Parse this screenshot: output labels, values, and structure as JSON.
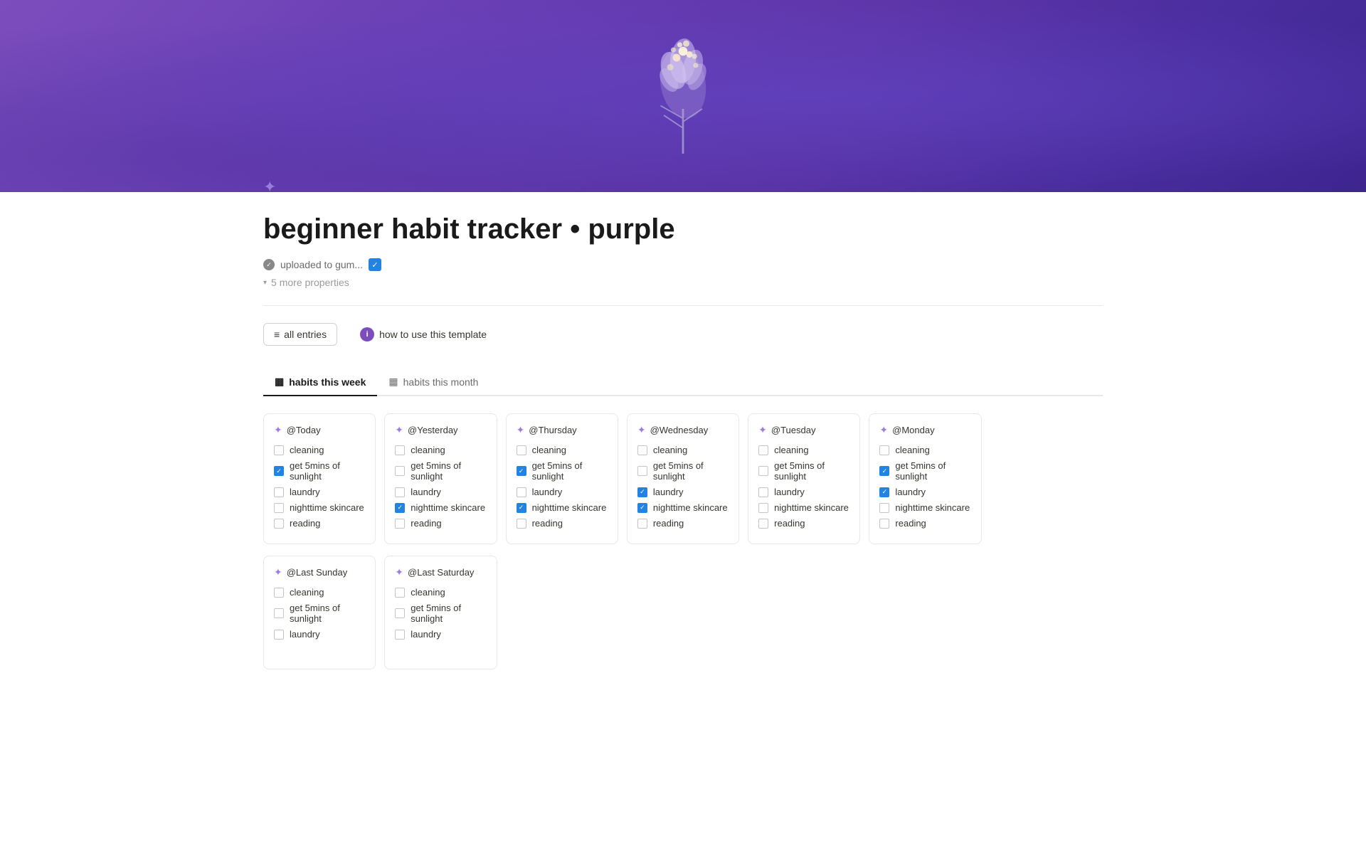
{
  "page": {
    "title": "beginner habit tracker • purple",
    "hero": {
      "alt": "Purple flower bouquet on purple background"
    },
    "properties": {
      "verified_label": "uploaded to gum...",
      "more_label": "5 more properties"
    },
    "actions": {
      "all_entries": "all entries",
      "how_to": "how to use this template"
    },
    "tabs": [
      {
        "id": "habits-week",
        "label": "habits this week",
        "active": true
      },
      {
        "id": "habits-month",
        "label": "habits this month",
        "active": false
      }
    ],
    "week_cards": [
      {
        "day": "@Today",
        "habits": [
          {
            "label": "cleaning",
            "checked": false
          },
          {
            "label": "get 5mins of sunlight",
            "checked": true
          },
          {
            "label": "laundry",
            "checked": false
          },
          {
            "label": "nighttime skincare",
            "checked": false
          },
          {
            "label": "reading",
            "checked": false
          }
        ]
      },
      {
        "day": "@Yesterday",
        "habits": [
          {
            "label": "cleaning",
            "checked": false
          },
          {
            "label": "get 5mins of sunlight",
            "checked": false
          },
          {
            "label": "laundry",
            "checked": false
          },
          {
            "label": "nighttime skincare",
            "checked": true
          },
          {
            "label": "reading",
            "checked": false
          }
        ]
      },
      {
        "day": "@Thursday",
        "habits": [
          {
            "label": "cleaning",
            "checked": false
          },
          {
            "label": "get 5mins of sunlight",
            "checked": true
          },
          {
            "label": "laundry",
            "checked": false
          },
          {
            "label": "nighttime skincare",
            "checked": true
          },
          {
            "label": "reading",
            "checked": false
          }
        ]
      },
      {
        "day": "@Wednesday",
        "habits": [
          {
            "label": "cleaning",
            "checked": false
          },
          {
            "label": "get 5mins of sunlight",
            "checked": false
          },
          {
            "label": "laundry",
            "checked": true
          },
          {
            "label": "nighttime skincare",
            "checked": true
          },
          {
            "label": "reading",
            "checked": false
          }
        ]
      },
      {
        "day": "@Tuesday",
        "habits": [
          {
            "label": "cleaning",
            "checked": false
          },
          {
            "label": "get 5mins of sunlight",
            "checked": false
          },
          {
            "label": "laundry",
            "checked": false
          },
          {
            "label": "nighttime skincare",
            "checked": false
          },
          {
            "label": "reading",
            "checked": false
          }
        ]
      },
      {
        "day": "@Monday",
        "habits": [
          {
            "label": "cleaning",
            "checked": false
          },
          {
            "label": "get 5mins of sunlight",
            "checked": true
          },
          {
            "label": "laundry",
            "checked": true
          },
          {
            "label": "nighttime skincare",
            "checked": false
          },
          {
            "label": "reading",
            "checked": false
          }
        ]
      }
    ],
    "bottom_cards": [
      {
        "day": "@Last Sunday",
        "habits": [
          {
            "label": "cleaning",
            "checked": false
          },
          {
            "label": "get 5mins of sunlight",
            "checked": false
          },
          {
            "label": "laundry",
            "checked": false
          }
        ]
      },
      {
        "day": "@Last Saturday",
        "habits": [
          {
            "label": "cleaning",
            "checked": false
          },
          {
            "label": "get 5mins of sunlight",
            "checked": false
          },
          {
            "label": "laundry",
            "checked": false
          }
        ]
      }
    ]
  }
}
